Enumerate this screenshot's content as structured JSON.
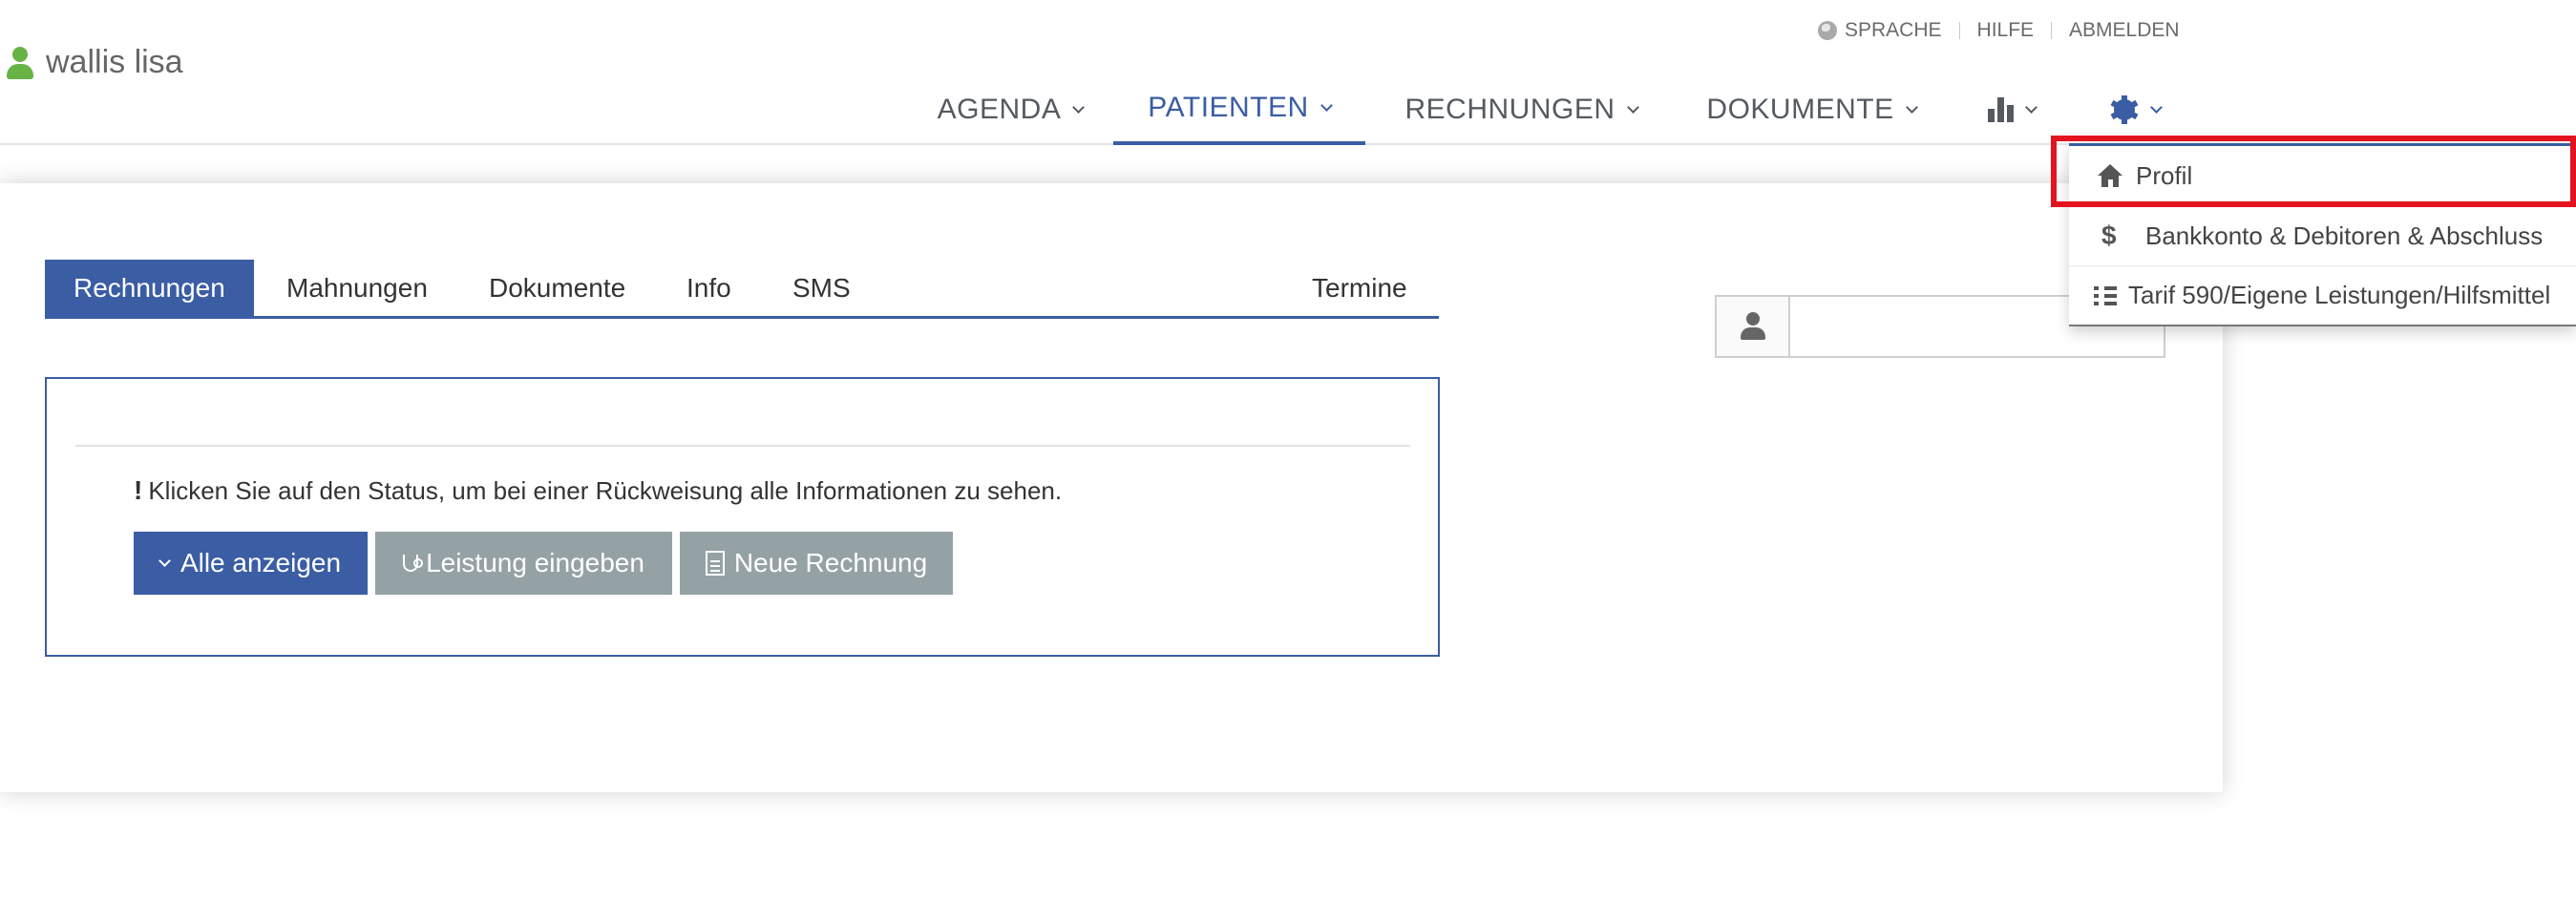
{
  "header": {
    "user_name": "wallis lisa",
    "links": {
      "language": "SPRACHE",
      "help": "HILFE",
      "logout": "ABMELDEN"
    }
  },
  "nav": {
    "items": [
      {
        "label": "AGENDA"
      },
      {
        "label": "PATIENTEN"
      },
      {
        "label": "RECHNUNGEN"
      },
      {
        "label": "DOKUMENTE"
      }
    ],
    "active": "PATIENTEN",
    "icons": [
      "bar-chart-icon",
      "gear-icon"
    ]
  },
  "settings_menu": {
    "items": [
      {
        "label": "Profil",
        "icon": "home-icon"
      },
      {
        "label": "Bankkonto & Debitoren & Abschluss",
        "icon": "dollar-icon",
        "symbol": "$"
      },
      {
        "label": "Tarif 590/Eigene Leistungen/Hilfsmittel",
        "icon": "list-icon"
      }
    ],
    "highlighted": "Profil"
  },
  "tabs": {
    "items": [
      {
        "label": "Rechnungen"
      },
      {
        "label": "Mahnungen"
      },
      {
        "label": "Dokumente"
      },
      {
        "label": "Info"
      },
      {
        "label": "SMS"
      },
      {
        "label": "Termine"
      }
    ],
    "active": "Rechnungen"
  },
  "patient_search": {
    "value": "",
    "placeholder": ""
  },
  "invoices_panel": {
    "exclamation": "!",
    "note": "Klicken Sie auf den Status, um bei einer Rückweisung alle Informationen zu sehen.",
    "buttons": {
      "show_all": "Alle anzeigen",
      "enter_service": "Leistung eingeben",
      "new_invoice": "Neue Rechnung"
    }
  },
  "colors": {
    "primary": "#3a5da4",
    "grey_button": "#95a2a5",
    "user_icon": "#67b346",
    "highlight": "#e3141f"
  }
}
